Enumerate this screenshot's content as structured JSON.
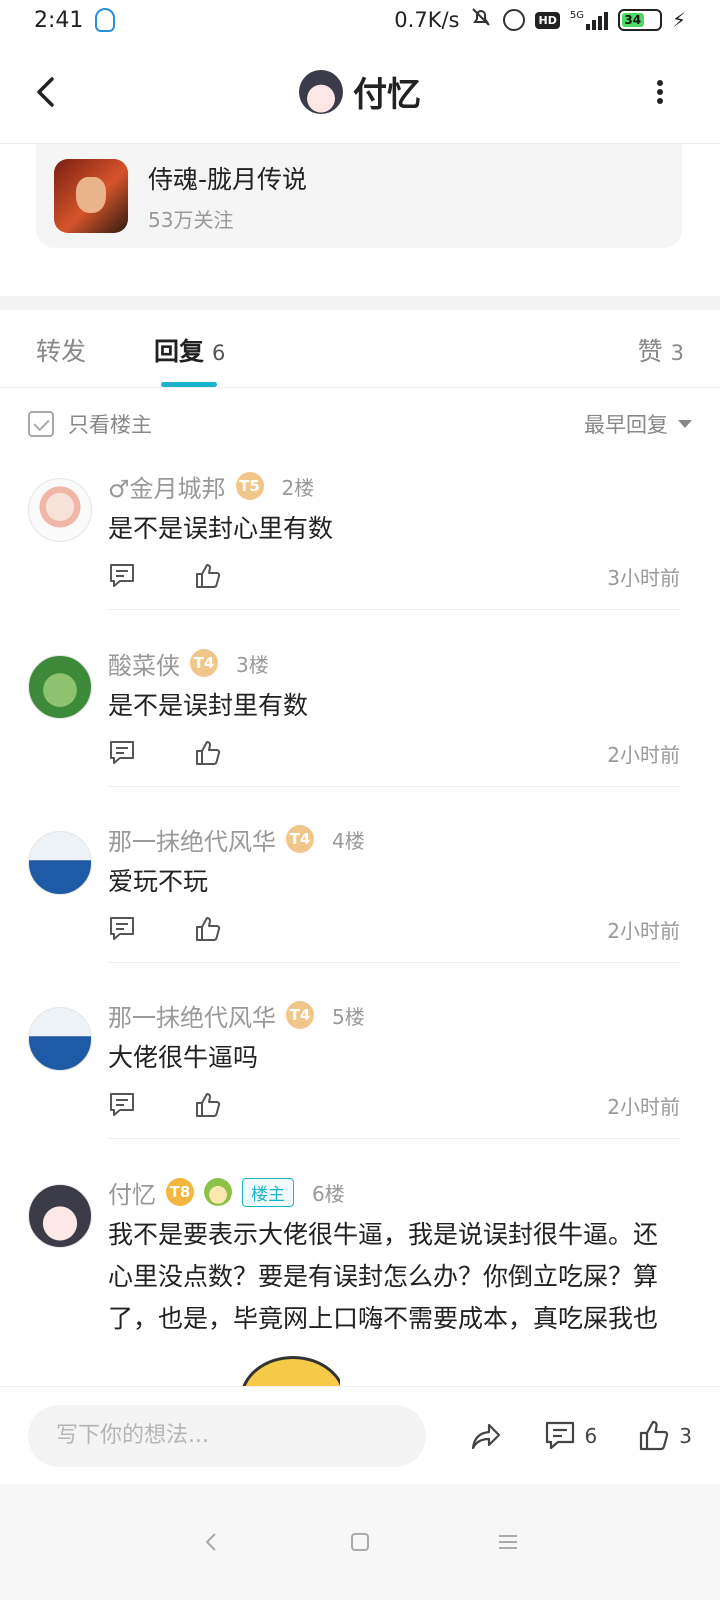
{
  "status_bar": {
    "time": "2:41",
    "speed": "0.7K/s",
    "network": "5G",
    "battery": "34",
    "icons": [
      "qq-icon",
      "mute-icon",
      "alarm-icon",
      "hd-icon",
      "signal-icon",
      "battery-icon",
      "charging-icon"
    ]
  },
  "header": {
    "title": "付忆"
  },
  "community": {
    "name": "侍魂-胧月传说",
    "followers": "53万关注"
  },
  "tabs": {
    "forward": {
      "label": "转发"
    },
    "reply": {
      "label": "回复",
      "count": "6"
    },
    "like": {
      "label": "赞",
      "count": "3"
    },
    "active": "reply"
  },
  "filter": {
    "owner_only_label": "只看楼主",
    "sort_label": "最早回复"
  },
  "comments": [
    {
      "name": "♂金月城邦",
      "level": "T5",
      "level_digit": "5",
      "floor": "2楼",
      "text": "是不是误封心里有数",
      "time": "3小时前"
    },
    {
      "name": "酸菜侠",
      "level": "T4",
      "level_digit": "4",
      "floor": "3楼",
      "text": "是不是误封里有数",
      "time": "2小时前"
    },
    {
      "name": "那一抹绝代风华",
      "level": "T4",
      "level_digit": "4",
      "floor": "4楼",
      "text": "爱玩不玩",
      "time": "2小时前"
    },
    {
      "name": "那一抹绝代风华",
      "level": "T4",
      "level_digit": "4",
      "floor": "5楼",
      "text": "大佬很牛逼吗",
      "time": "2小时前"
    },
    {
      "name": "付忆",
      "level": "T8",
      "level_digit": "8",
      "owner_badge": "楼主",
      "floor": "6楼",
      "text": "我不是要表示大佬很牛逼，我是说误封很牛逼。还心里没点数？要是有误封怎么办？你倒立吃屎？算了，也是，毕竟网上口嗨不需要成本，真吃屎我也"
    }
  ],
  "bottom_bar": {
    "input_placeholder": "写下你的想法...",
    "comment_count": "6",
    "like_count": "3"
  },
  "colors": {
    "accent": "#19b4c9",
    "level_badge": "#f2c58a"
  }
}
